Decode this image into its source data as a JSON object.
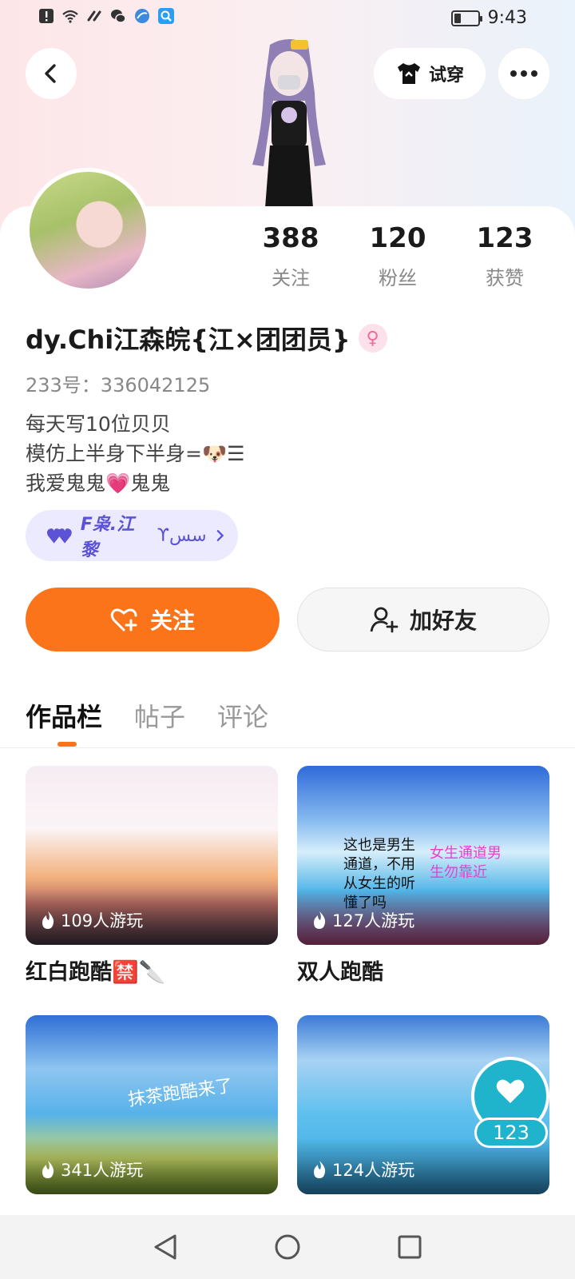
{
  "status_bar": {
    "time": "9:43",
    "battery_level": 0.3
  },
  "header": {
    "back_icon": "chevron-left-icon",
    "tryon_label": "试穿",
    "more_icon": "more-dots-icon"
  },
  "profile": {
    "stats": [
      {
        "value": "388",
        "label": "关注"
      },
      {
        "value": "120",
        "label": "粉丝"
      },
      {
        "value": "123",
        "label": "获赞"
      }
    ],
    "username": "dy.Chi江森皖{江×团团员}",
    "id_line": "233号：336042125",
    "bio": [
      "每天写10位贝贝",
      "模仿上半身下半身=🐶☰",
      "我爱鬼鬼💗鬼鬼"
    ],
    "group_tag": "F枭.江黎",
    "group_tag_suffix": "ϒسس"
  },
  "actions": {
    "follow_label": "关注",
    "add_friend_label": "加好友"
  },
  "tabs": [
    {
      "label": "作品栏",
      "active": true
    },
    {
      "label": "帖子",
      "active": false
    },
    {
      "label": "评论",
      "active": false
    }
  ],
  "works": [
    {
      "plays": "109人游玩",
      "title": "红白跑酷🈲🔪"
    },
    {
      "plays": "127人游玩",
      "title": "双人跑酷",
      "overlay_left": "这也是男生通道，不用从女生的听懂了吗",
      "overlay_right": "女生通道男生勿靠近"
    },
    {
      "plays": "341人游玩",
      "title": "",
      "overlay": "抹茶跑酷来了"
    },
    {
      "plays": "124人游玩",
      "title": ""
    }
  ],
  "floating_like": {
    "count": "123"
  },
  "colors": {
    "accent": "#fb7419",
    "pill_text": "#5b52d6",
    "like_bg": "#1fb3cc"
  }
}
